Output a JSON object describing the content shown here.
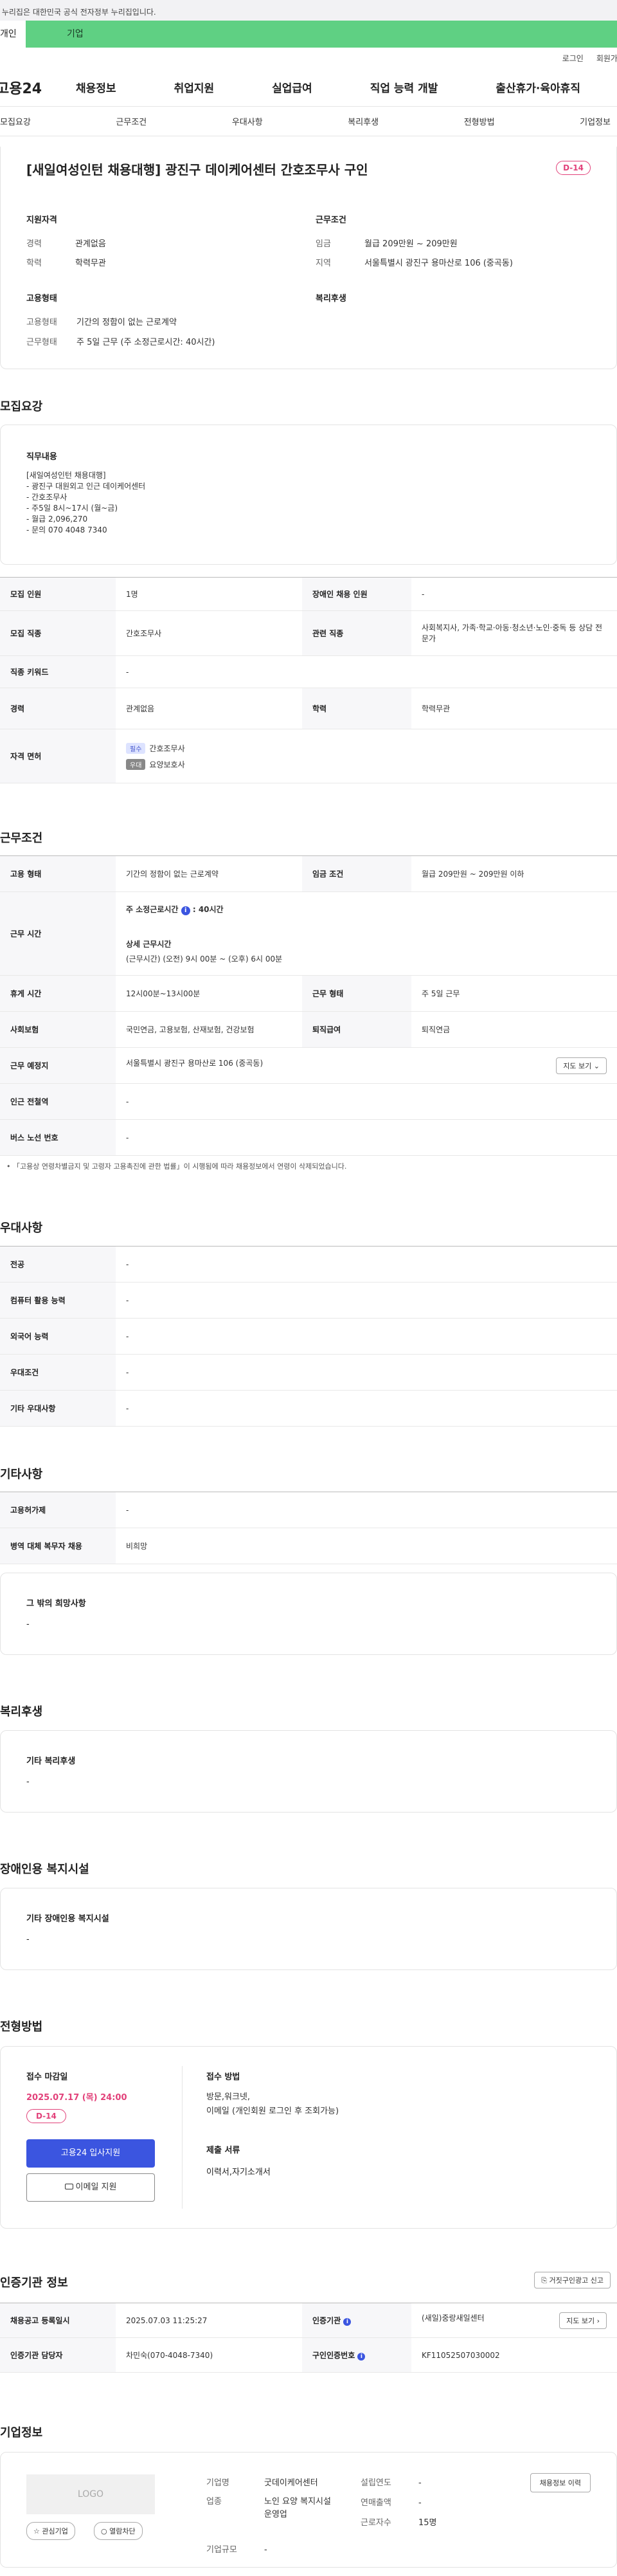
{
  "gov_notice": "이 누리집은 대한민국 공식 전자정부 누리집입니다.",
  "tabs": [
    "개인",
    "기업"
  ],
  "util": [
    "로그인",
    "회원가입"
  ],
  "logo": "고용24",
  "gnb": [
    "채용정보",
    "취업지원",
    "실업급여",
    "직업 능력 개발",
    "출산휴가·육아휴직"
  ],
  "subnav": [
    "모집요강",
    "근무조건",
    "우대사항",
    "복리후생",
    "전형방법",
    "기업정보"
  ],
  "job": {
    "title": "[새일여성인턴 채용대행] 광진구 데이케어센터 간호조무사 구인",
    "dday": "D-14",
    "qual_title": "지원자격",
    "cond_title": "근무조건",
    "emp_title": "고용형태",
    "welfare_title": "복리후생",
    "qual": [
      {
        "k": "경력",
        "v": "관계없음"
      },
      {
        "k": "학력",
        "v": "학력무관"
      }
    ],
    "cond": [
      {
        "k": "임금",
        "v": "월급 209만원 ~ 209만원"
      },
      {
        "k": "지역",
        "v": "서울특별시 광진구 용마산로 106 (중곡동)"
      }
    ],
    "emp": [
      {
        "k": "고용형태",
        "v": "기간의 정함이 없는 근로계약"
      },
      {
        "k": "근무형태",
        "v": "주 5일 근무 (주 소정근로시간: 40시간)"
      }
    ]
  },
  "recruit": {
    "title": "모집요강",
    "duty_title": "직무내용",
    "duty_text": "[새일여성인턴 채용대행]\n- 광진구 대원외고 인근 데이케어센터\n- 간호조무사\n- 주5일 8시~17시 (월~금)\n- 월급 2,096,270\n- 문의 070 4048 7340",
    "rows": {
      "count_h": "모집 인원",
      "count_v": "1명",
      "disabled_h": "장애인 채용 인원",
      "disabled_v": "-",
      "job_h": "모집 직종",
      "job_v": "간호조무사",
      "related_h": "관련 직종",
      "related_v": "사회복지사, 가족·학교·아동·청소년·노인·중독 등 상담 전문가",
      "keyword_h": "직종 키워드",
      "keyword_v": "-",
      "career_h": "경력",
      "career_v": "관계없음",
      "edu_h": "학력",
      "edu_v": "학력무관",
      "license_h": "자격 면허",
      "license": [
        {
          "badge": "필수",
          "name": "간호조무사",
          "color": "#dde3ff",
          "tcolor": "#4455cc"
        },
        {
          "badge": "우대",
          "name": "요양보호사",
          "color": "#888",
          "tcolor": "#fff"
        }
      ]
    }
  },
  "work": {
    "title": "근무조건",
    "type_h": "고용 형태",
    "type_v": "기간의 정함이 없는 근로계약",
    "wage_h": "임금 조건",
    "wage_v": "월급 209만원 ~ 209만원 이하",
    "hours_h": "근무 시간",
    "hours_main": "주 소정근로시간",
    "hours_num": "40시간",
    "hours_detail_t": "상세 근무시간",
    "hours_detail": "(근무시간) (오전) 9시 00분 ~ (오후) 6시 00분",
    "rest_h": "휴게 시간",
    "rest_v": "12시00분~13시00분",
    "shift_h": "근무 형태",
    "shift_v": "주 5일 근무",
    "ins_h": "사회보험",
    "ins_v": "국민연금, 고용보험, 산재보험, 건강보험",
    "pension_h": "퇴직급여",
    "pension_v": "퇴직연금",
    "place_h": "근무 예정지",
    "place_v": "서울특별시 광진구 용마산로 106 (중곡동)",
    "map_btn": "지도 보기 ⌄",
    "subway_h": "인근 전철역",
    "subway_v": "-",
    "bus_h": "버스 노선 번호",
    "bus_v": "-",
    "note": "「고용상 연령차별금지 및 고령자 고용촉진에 관한 법률」이 시행됨에 따라 채용정보에서 연령이 삭제되었습니다."
  },
  "pref": {
    "title": "우대사항",
    "rows": [
      {
        "h": "전공",
        "v": "-"
      },
      {
        "h": "컴퓨터 활용 능력",
        "v": "-"
      },
      {
        "h": "외국어 능력",
        "v": "-"
      },
      {
        "h": "우대조건",
        "v": "-"
      },
      {
        "h": "기타 우대사항",
        "v": "-"
      }
    ]
  },
  "etc": {
    "title": "기타사항",
    "rows": [
      {
        "h": "고용허가제",
        "v": "-"
      },
      {
        "h": "병역 대체 복무자 채용",
        "v": "비희망"
      }
    ],
    "other_t": "그 밖의 희망사항",
    "other_v": "-"
  },
  "welfare": {
    "title": "복리후생",
    "box_t": "기타 복리후생",
    "box_v": "-"
  },
  "disab": {
    "title": "장애인용 복지시설",
    "box_t": "기타 장애인용 복지시설",
    "box_v": "-"
  },
  "select": {
    "title": "전형방법",
    "deadline_t": "접수 마감일",
    "deadline": "2025.07.17 (목) 24:00",
    "dday": "D-14",
    "apply_btn": "고용24 입사지원",
    "email_btn": "이메일 지원",
    "method_t": "접수 방법",
    "method_v": "방문,워크넷,\n이메일 (개인회원 로그인 후 조회가능)",
    "docs_t": "제출 서류",
    "docs_v": "이력서,자기소개서"
  },
  "cert": {
    "title": "인증기관 정보",
    "report_btn": "거짓구인광고 신고",
    "reg_h": "채용공고 등록일시",
    "reg_v": "2025.07.03 11:25:27",
    "org_h": "인증기관",
    "org_v": "(새일)중랑새일센터",
    "org_btn": "지도 보기 ›",
    "mgr_h": "인증기관 담당자",
    "mgr_v": "차민숙(070-4048-7340)",
    "no_h": "구인인증번호",
    "no_v": "KF11052507030002"
  },
  "company": {
    "title": "기업정보",
    "logo": "LOGO",
    "fav_btn": "관심기업",
    "block_btn": "열람차단",
    "info_btn": "채용정보 이력",
    "name_k": "기업명",
    "name_v": "굿데이케어센터",
    "biz_k": "업종",
    "biz_v": "노인 요양 복지시설 운영업",
    "size_k": "기업규모",
    "size_v": "-",
    "year_k": "설립연도",
    "year_v": "-",
    "sales_k": "연매출액",
    "sales_v": "-",
    "emp_k": "근로자수",
    "emp_v": "15명"
  }
}
